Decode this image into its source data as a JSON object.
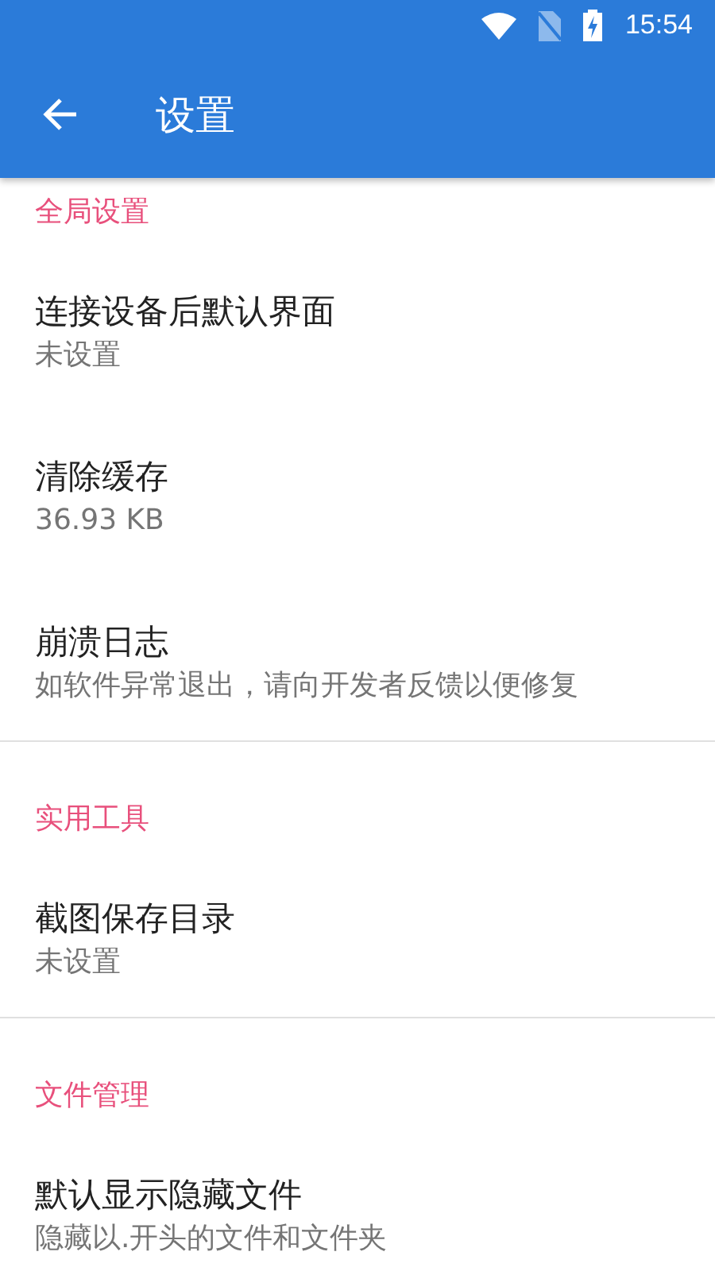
{
  "status_bar": {
    "time": "15:54"
  },
  "app_bar": {
    "title": "设置"
  },
  "sections": [
    {
      "title": "全局设置",
      "items": [
        {
          "title": "连接设备后默认界面",
          "subtitle": "未设置"
        },
        {
          "title": "清除缓存",
          "subtitle": "36.93 KB"
        },
        {
          "title": "崩溃日志",
          "subtitle": "如软件异常退出，请向开发者反馈以便修复"
        }
      ]
    },
    {
      "title": "实用工具",
      "items": [
        {
          "title": "截图保存目录",
          "subtitle": "未设置"
        }
      ]
    },
    {
      "title": "文件管理",
      "items": [
        {
          "title": "默认显示隐藏文件",
          "subtitle": "隐藏以.开头的文件和文件夹"
        }
      ]
    }
  ]
}
